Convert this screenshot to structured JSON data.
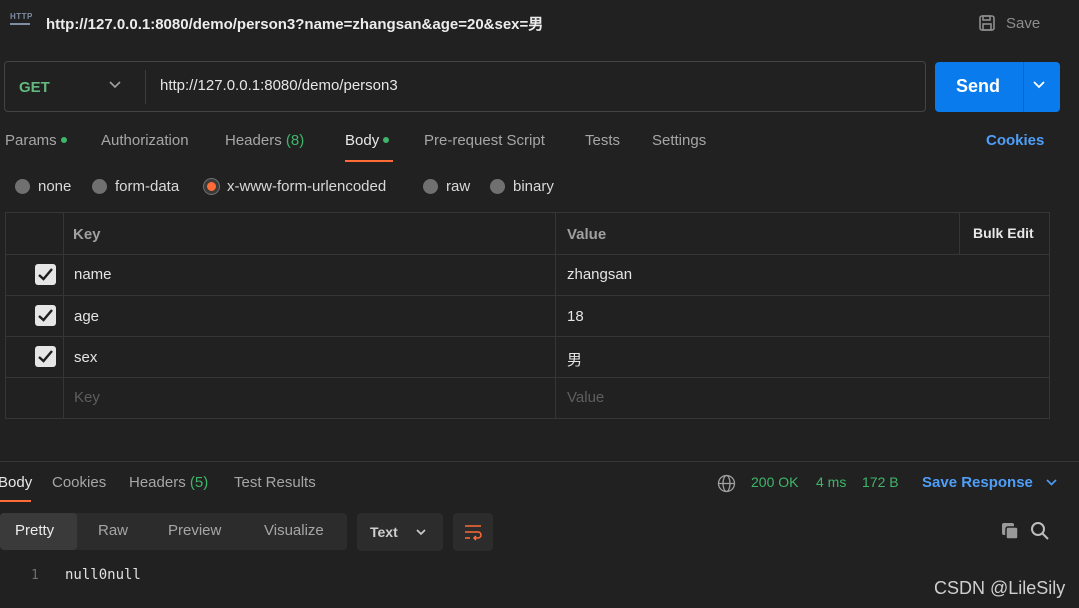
{
  "request": {
    "tab_title": "http://127.0.0.1:8080/demo/person3?name=zhangsan&age=20&sex=男",
    "save_label": "Save",
    "method": "GET",
    "url": "http://127.0.0.1:8080/demo/person3",
    "send_label": "Send"
  },
  "request_tabs": {
    "params": "Params",
    "authorization": "Authorization",
    "headers": "Headers",
    "headers_count": "(8)",
    "body": "Body",
    "prerequest": "Pre-request Script",
    "tests": "Tests",
    "settings": "Settings",
    "cookies": "Cookies"
  },
  "body_types": {
    "none": "none",
    "form_data": "form-data",
    "urlencoded": "x-www-form-urlencoded",
    "raw": "raw",
    "binary": "binary",
    "selected": "x-www-form-urlencoded"
  },
  "table": {
    "key_header": "Key",
    "value_header": "Value",
    "bulk_edit": "Bulk Edit",
    "rows": [
      {
        "key": "name",
        "value": "zhangsan",
        "checked": true
      },
      {
        "key": "age",
        "value": "18",
        "checked": true
      },
      {
        "key": "sex",
        "value": "男",
        "checked": true
      }
    ],
    "key_placeholder": "Key",
    "value_placeholder": "Value"
  },
  "response": {
    "tabs": {
      "body": "Body",
      "cookies": "Cookies",
      "headers": "Headers",
      "headers_count": "(5)",
      "test_results": "Test Results"
    },
    "status": "200 OK",
    "time": "4 ms",
    "size": "172 B",
    "save_response": "Save Response",
    "views": {
      "pretty": "Pretty",
      "raw": "Raw",
      "preview": "Preview",
      "visualize": "Visualize"
    },
    "format": "Text",
    "line_number": "1",
    "content": "null0null"
  },
  "watermark": "CSDN @LileSily",
  "colors": {
    "accent": "#ff6c37",
    "send": "#097bed",
    "link": "#4f9ef8",
    "success": "#3fb56a",
    "method_get": "#62b87d"
  }
}
